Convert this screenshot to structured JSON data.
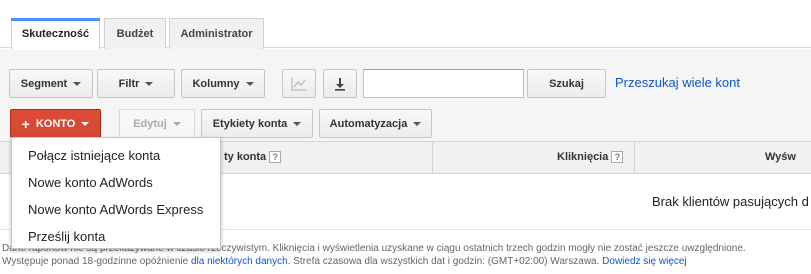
{
  "tabs": [
    {
      "label": "Skuteczność",
      "active": true
    },
    {
      "label": "Budżet",
      "active": false
    },
    {
      "label": "Administrator",
      "active": false
    }
  ],
  "toolbar": {
    "segment_label": "Segment",
    "filter_label": "Filtr",
    "columns_label": "Kolumny",
    "chart_icon": "line-chart-icon",
    "download_icon": "download-icon",
    "search_value": "",
    "search_button_label": "Szukaj",
    "multi_search_link": "Przeszukaj wiele kont"
  },
  "actions": {
    "account_label": "KONTO",
    "account_color": "#d14836",
    "edit_label": "Edytuj",
    "labels_label": "Etykiety konta",
    "automation_label": "Automatyzacja"
  },
  "table": {
    "columns": [
      {
        "label": "ty konta"
      },
      {
        "label": "Kliknięcia"
      },
      {
        "label": "Wyśw"
      }
    ],
    "help_mark": "?",
    "empty_message": "Brak klientów pasujących d"
  },
  "menu": {
    "items": [
      "Połącz istniejące konta",
      "Nowe konto AdWords",
      "Nowe konto AdWords Express",
      "Prześlij konta"
    ]
  },
  "footnote": {
    "line1": "Dane raportów nie są przekazywane w czasie rzeczywistym. Kliknięcia i wyświetlenia uzyskane w ciągu ostatnich trzech godzin mogły nie zostać jeszcze uwzględnione.",
    "line2_prefix": "Występuje ponad 18-godzinne opóźnienie",
    "line2_link": "dla niektórych danych",
    "line2_middle": ". Strefa czasowa dla wszystkich dat i godzin: (GMT+02:00) Warszawa.",
    "line2_link2": "Dowiedz się więcej"
  }
}
